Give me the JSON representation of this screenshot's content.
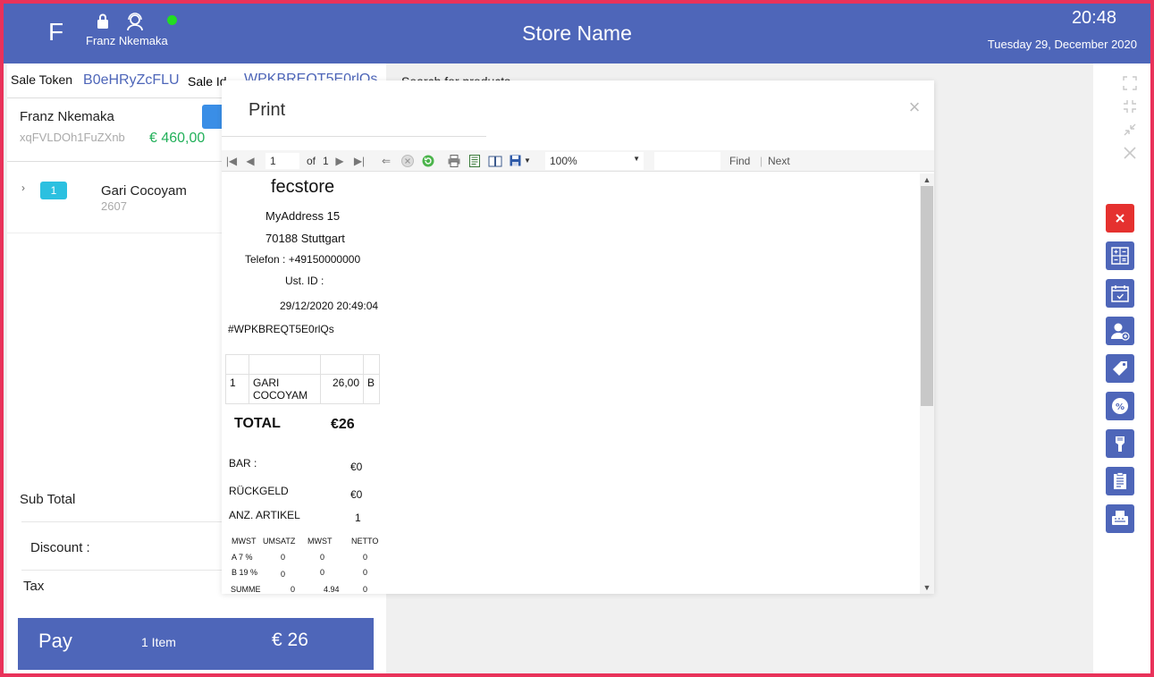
{
  "header": {
    "avatar_letter": "F",
    "user_name": "Franz Nkemaka",
    "store_name": "Store Name",
    "time": "20:48",
    "date": "Tuesday 29, December  2020",
    "status_color": "#22dd22"
  },
  "sale": {
    "token_label": "Sale Token",
    "token_value": "B0eHRyZcFLU",
    "id_label": "Sale Id",
    "id_value": "WPKBREQT5E0rlQs"
  },
  "customer": {
    "name": "Franz  Nkemaka",
    "id": "xqFVLDOh1FuZXnb",
    "balance": "€ 460,00"
  },
  "cart_items": [
    {
      "qty": "1",
      "name": "Gari Cocoyam",
      "code": "2607"
    }
  ],
  "summary": {
    "subtotal_label": "Sub Total",
    "discount_label": "Discount :",
    "tax_label": "Tax"
  },
  "pay": {
    "label": "Pay",
    "count": "1 Item",
    "total": "€ 26"
  },
  "search": {
    "placeholder": "Search for products"
  },
  "dialog": {
    "title": "Print",
    "toolbar": {
      "page": "1",
      "of_label": "of",
      "total_pages": "1",
      "zoom": "100%",
      "find_label": "Find",
      "next_label": "Next"
    },
    "receipt": {
      "store": "fecstore",
      "address1": "MyAddress 15",
      "address2": "70188 Stuttgart",
      "phone": "Telefon : +49150000000",
      "ust": "Ust. ID :",
      "datetime": "29/12/2020 20:49:04",
      "sale_ref": "#WPKBREQT5E0rlQs",
      "line_items": [
        {
          "qty": "1",
          "name": "GARI COCOYAM",
          "price": "26,00",
          "tax_code": "B"
        }
      ],
      "total_label": "TOTAL",
      "total_value": "€26",
      "bar_label": "BAR :",
      "bar_value": "€0",
      "change_label": "RÜCKGELD",
      "change_value": "€0",
      "count_label": "ANZ. ARTIKEL",
      "count_value": "1",
      "tax_table": {
        "headers": [
          "MWST",
          "UMSATZ",
          "MWST",
          "NETTO"
        ],
        "rows": [
          [
            "A 7 %",
            "0",
            "0",
            "0"
          ],
          [
            "B 19 %",
            "0",
            "0",
            "0"
          ],
          [
            "SUMME",
            "0",
            "4.94",
            "0"
          ]
        ]
      }
    }
  },
  "sidebar_icons": [
    "close-icon",
    "calculator-icon",
    "calendar-icon",
    "add-user-icon",
    "tag-icon",
    "percent-badge-icon",
    "barcode-scanner-icon",
    "clipboard-list-icon",
    "receipt-printer-icon"
  ]
}
